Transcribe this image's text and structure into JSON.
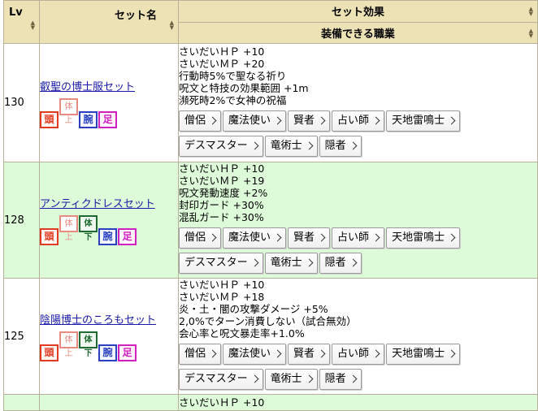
{
  "headers": {
    "lv": "Lv",
    "set_name": "セット名",
    "set_effect": "セット効果",
    "equip_jobs": "装備できる職業"
  },
  "rows": [
    {
      "lv": "130",
      "name": "叡聖の博士服セット",
      "parts": [
        "頭",
        "体上",
        "腕",
        "足"
      ],
      "effects": [
        "さいだいＨＰ +10",
        "さいだいＭＰ +20",
        "行動時5%で聖なる祈り",
        "呪文と特技の効果範囲 +1m",
        "瀕死時2%で女神の祝福"
      ],
      "jobs": [
        "僧侶",
        "魔法使い",
        "賢者",
        "占い師",
        "天地雷鳴士",
        "デスマスター",
        "竜術士",
        "隠者"
      ]
    },
    {
      "lv": "128",
      "name": "アンティクドレスセット",
      "parts": [
        "頭",
        "体上",
        "体下",
        "腕",
        "足"
      ],
      "effects": [
        "さいだいＨＰ +10",
        "さいだいＭＰ +19",
        "呪文発動速度 +2%",
        "封印ガード +30%",
        "混乱ガード +30%"
      ],
      "jobs": [
        "僧侶",
        "魔法使い",
        "賢者",
        "占い師",
        "天地雷鳴士",
        "デスマスター",
        "竜術士",
        "隠者"
      ]
    },
    {
      "lv": "125",
      "name": "陰陽博士のころもセット",
      "parts": [
        "頭",
        "体上",
        "体下",
        "腕",
        "足"
      ],
      "effects": [
        "さいだいＨＰ +10",
        "さいだいＭＰ +18",
        "炎・土・闇の攻撃ダメージ +5%",
        "2,0%でターン消費しない（試合無効）",
        "会心率と呪文暴走率+1.0%"
      ],
      "jobs": [
        "僧侶",
        "魔法使い",
        "賢者",
        "占い師",
        "天地雷鳴士",
        "デスマスター",
        "竜術士",
        "隠者"
      ]
    }
  ],
  "partial_row_text": "さいだいＨＰ +10"
}
